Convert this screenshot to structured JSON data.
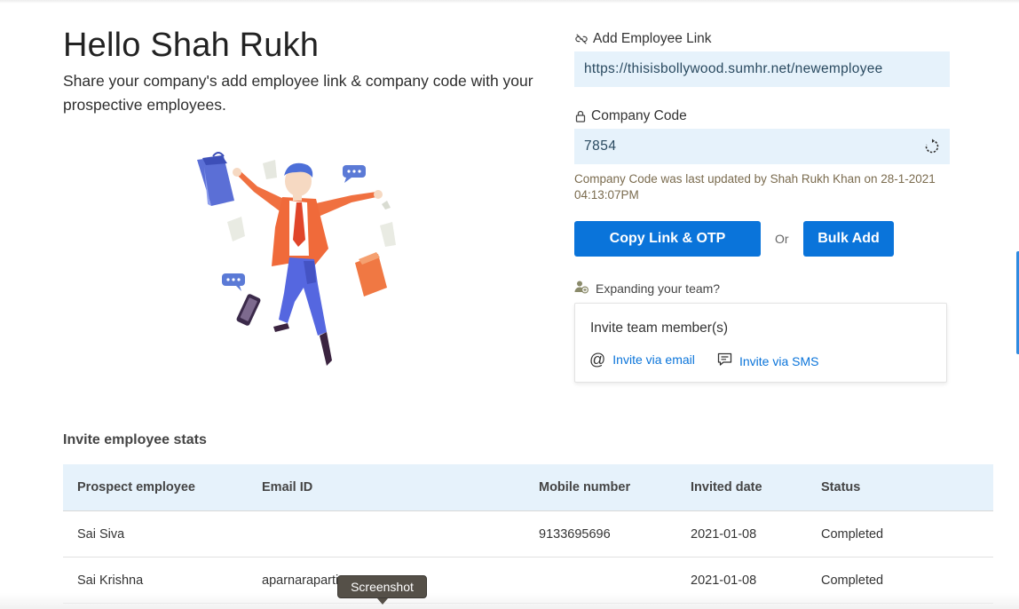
{
  "header": {
    "greeting": "Hello Shah Rukh",
    "subtitle": "Share your company's add employee link & company code with your prospective employees."
  },
  "link_field": {
    "label": "Add Employee Link",
    "value": "https://thisisbollywood.sumhr.net/newemployee",
    "icon": "link-off-icon"
  },
  "code_field": {
    "label": "Company Code",
    "value": "7854",
    "icon": "lock-icon",
    "refresh_icon": "refresh-icon",
    "updated_note": "Company Code was last updated by Shah Rukh Khan on  28-1-2021 04:13:07PM"
  },
  "actions": {
    "copy_label": "Copy Link & OTP",
    "or_label": "Or",
    "bulk_label": "Bulk Add"
  },
  "invite": {
    "prompt": "Expanding your team?",
    "title": "Invite team member(s)",
    "email_label": "Invite via email",
    "sms_label": "Invite via SMS",
    "email_icon": "at-icon",
    "sms_icon": "message-icon"
  },
  "stats": {
    "title": "Invite employee stats",
    "columns": [
      "Prospect employee",
      "Email ID",
      "Mobile number",
      "Invited date",
      "Status"
    ],
    "rows": [
      [
        "Sai Siva",
        "",
        "9133695696",
        "2021-01-08",
        "Completed"
      ],
      [
        "Sai Krishna",
        "aparnaraparti",
        "",
        "2021-01-08",
        "Completed"
      ]
    ]
  },
  "tooltip": {
    "label": "Screenshot"
  },
  "colors": {
    "accent": "#0a74da",
    "field_bg": "#e6f2fb",
    "note_text": "#7a6b4e"
  }
}
